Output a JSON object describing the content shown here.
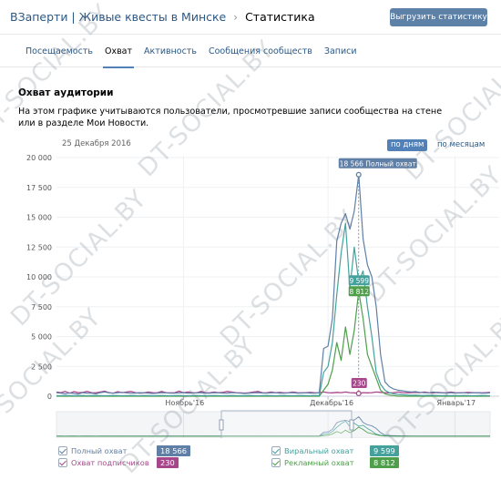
{
  "header": {
    "crumb_group": "ВЗаперти | Живые квесты в Минске",
    "crumb_separator": "›",
    "crumb_page": "Статистика",
    "export_label": "Выгрузить статистику"
  },
  "tabs": [
    {
      "label": "Посещаемость",
      "active": false
    },
    {
      "label": "Охват",
      "active": true
    },
    {
      "label": "Активность",
      "active": false
    },
    {
      "label": "Сообщения сообществ",
      "active": false
    },
    {
      "label": "Записи",
      "active": false
    }
  ],
  "section": {
    "title": "Охват аудитории",
    "description": "На этом графике учитываются пользователи, просмотревшие записи сообщества на стене или в разделе Мои Новости."
  },
  "chart_controls": {
    "date": "25 Декабря 2016",
    "by_days": "по дням",
    "by_months": "по месяцам"
  },
  "tooltip": {
    "full_label": "18 566 Полный охват"
  },
  "point_labels": {
    "viral": "9 599",
    "ads": "8 812",
    "subscribers": "230"
  },
  "legend": [
    {
      "name": "Полный охват",
      "value": "18 566",
      "color": "#5f7fa6",
      "checked": true
    },
    {
      "name": "Охват подписчиков",
      "value": "230",
      "color": "#a8468b",
      "checked": true
    },
    {
      "name": "Виральный охват",
      "value": "9 599",
      "color": "#45a19c",
      "checked": true
    },
    {
      "name": "Рекламный охват",
      "value": "8 812",
      "color": "#4e9e4a",
      "checked": true
    }
  ],
  "watermark": "DT-SOCIAL.BY",
  "chart_data": {
    "type": "line",
    "ylim": [
      0,
      20000
    ],
    "ytick_labels": [
      "0",
      "2 500",
      "5 000",
      "7 500",
      "10 000",
      "12 500",
      "15 000",
      "17 500",
      "20 000"
    ],
    "xtick_labels": [
      "Ноябрь'16",
      "Декабрь'16",
      "Январь'17"
    ],
    "highlight_day": "25 Декабря 2016",
    "series": [
      {
        "name": "Полный охват",
        "color": "#5f7fa6",
        "values": [
          300,
          250,
          200,
          280,
          220,
          180,
          300,
          260,
          250,
          200,
          300,
          350,
          280,
          250,
          300,
          320,
          280,
          250,
          260,
          300,
          280,
          250,
          230,
          260,
          300,
          280,
          250,
          260,
          280,
          300,
          250,
          270,
          280,
          300,
          260,
          250,
          300,
          280,
          260,
          250,
          300,
          280,
          250,
          230,
          260,
          280,
          300,
          270,
          250,
          280,
          300,
          260,
          250,
          280,
          300,
          250,
          270,
          280,
          250,
          260,
          300,
          4000,
          4200,
          6500,
          13000,
          14500,
          15300,
          14000,
          15500,
          18566,
          13200,
          11000,
          10000,
          7500,
          3500,
          1200,
          800,
          600,
          500,
          450,
          400,
          350,
          380,
          320,
          300,
          280,
          350,
          300,
          280,
          250,
          300,
          260,
          280,
          300,
          250,
          280,
          300,
          260,
          250,
          280
        ]
      },
      {
        "name": "Охват подписчиков",
        "color": "#a8468b",
        "values": [
          350,
          300,
          400,
          250,
          380,
          300,
          320,
          400,
          300,
          280,
          350,
          420,
          300,
          260,
          380,
          300,
          350,
          400,
          300,
          250,
          280,
          350,
          300,
          280,
          400,
          300,
          280,
          300,
          420,
          300,
          350,
          300,
          280,
          400,
          300,
          280,
          350,
          300,
          320,
          400,
          350,
          300,
          280,
          260,
          300,
          350,
          400,
          300,
          280,
          350,
          300,
          320,
          280,
          300,
          350,
          300,
          280,
          300,
          320,
          280,
          300,
          350,
          300,
          280,
          320,
          300,
          350,
          300,
          280,
          230,
          300,
          280,
          300,
          350,
          320,
          300,
          280,
          300,
          350,
          300,
          280,
          300,
          320,
          300,
          350,
          300,
          280,
          320,
          300,
          280,
          350,
          300,
          280,
          300,
          320,
          300,
          300,
          280,
          300,
          320
        ]
      },
      {
        "name": "Виральный охват",
        "color": "#45a19c",
        "values": [
          50,
          40,
          60,
          50,
          40,
          50,
          60,
          40,
          50,
          60,
          50,
          40,
          50,
          60,
          50,
          40,
          50,
          60,
          50,
          40,
          60,
          50,
          40,
          50,
          60,
          50,
          40,
          50,
          60,
          50,
          40,
          50,
          60,
          50,
          40,
          50,
          60,
          50,
          40,
          50,
          60,
          50,
          40,
          50,
          60,
          50,
          40,
          50,
          60,
          50,
          40,
          50,
          60,
          50,
          40,
          50,
          60,
          50,
          40,
          60,
          50,
          2000,
          2500,
          4500,
          8500,
          12000,
          14500,
          9000,
          12500,
          9599,
          10500,
          7500,
          5000,
          2000,
          1000,
          500,
          300,
          200,
          150,
          120,
          100,
          80,
          90,
          70,
          60,
          80,
          70,
          60,
          50,
          60,
          50,
          60,
          50,
          60,
          50,
          40,
          50,
          60,
          50,
          40
        ]
      },
      {
        "name": "Рекламный охват",
        "color": "#4e9e4a",
        "values": [
          0,
          0,
          0,
          0,
          0,
          0,
          0,
          0,
          0,
          0,
          0,
          0,
          0,
          0,
          0,
          0,
          0,
          0,
          0,
          0,
          0,
          0,
          0,
          0,
          0,
          0,
          0,
          0,
          0,
          0,
          0,
          0,
          0,
          0,
          0,
          0,
          0,
          0,
          0,
          0,
          0,
          0,
          0,
          0,
          0,
          0,
          0,
          0,
          0,
          0,
          0,
          0,
          0,
          0,
          0,
          0,
          0,
          0,
          0,
          0,
          0,
          500,
          1000,
          2200,
          4500,
          3000,
          5800,
          3500,
          5500,
          8812,
          6500,
          3500,
          2500,
          1500,
          500,
          200,
          100,
          50,
          0,
          0,
          0,
          0,
          0,
          0,
          0,
          0,
          0,
          0,
          0,
          0,
          0,
          0,
          0,
          0,
          0,
          0,
          0,
          0,
          0,
          0
        ]
      }
    ]
  }
}
